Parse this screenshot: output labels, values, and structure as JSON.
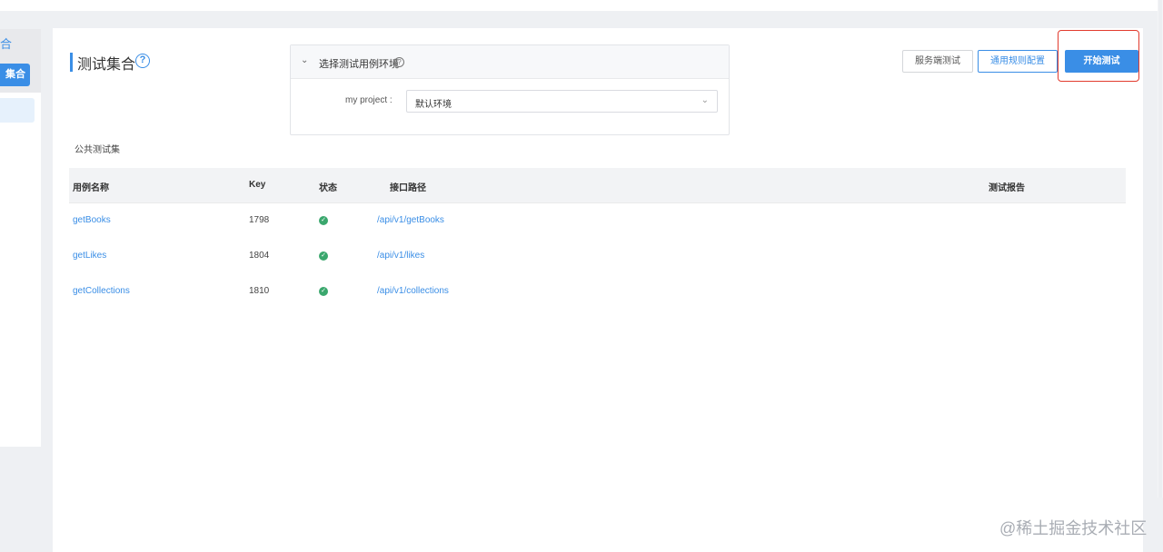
{
  "sidebar": {
    "section_label": "合",
    "active_item_label": "集合"
  },
  "page": {
    "title": "测试集合",
    "help_glyph": "?"
  },
  "environment": {
    "header_label": "选择测试用例环境",
    "project_label": "my project :",
    "selected_env": "默认环境"
  },
  "toolbar": {
    "server_test_label": "服务端测试",
    "rules_config_label": "通用规则配置",
    "start_test_label": "开始测试"
  },
  "section": {
    "label": "公共测试集"
  },
  "table": {
    "headers": {
      "name": "用例名称",
      "key": "Key",
      "status": "状态",
      "path": "接口路径",
      "report": "测试报告"
    },
    "rows": [
      {
        "name": "getBooks",
        "key": "1798",
        "status": "ok",
        "path": "/api/v1/getBooks"
      },
      {
        "name": "getLikes",
        "key": "1804",
        "status": "ok",
        "path": "/api/v1/likes"
      },
      {
        "name": "getCollections",
        "key": "1810",
        "status": "ok",
        "path": "/api/v1/collections"
      }
    ]
  },
  "watermark": "@稀土掘金技术社区",
  "colors": {
    "accent": "#3a8ee6",
    "status_ok": "#3aa76d",
    "highlight": "#e23b2e"
  }
}
